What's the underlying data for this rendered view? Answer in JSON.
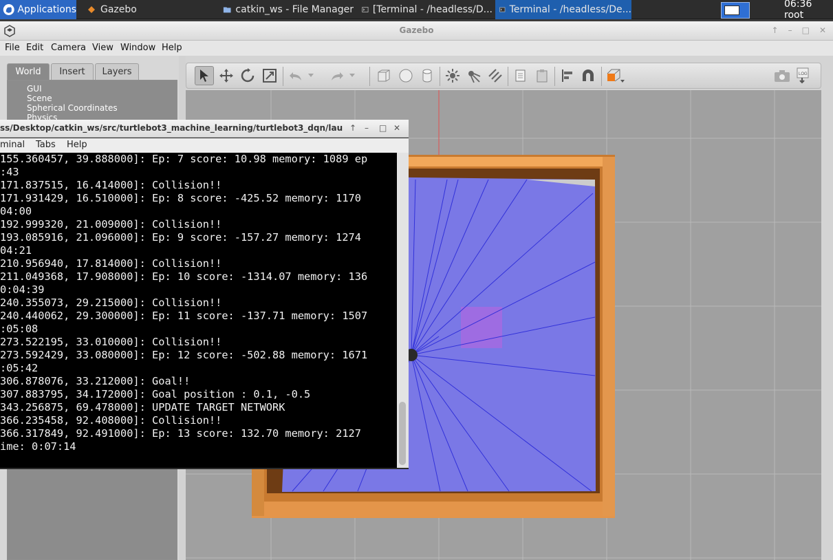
{
  "taskbar": {
    "apps_label": "Applications",
    "tasks": [
      "Gazebo",
      "catkin_ws - File Manager",
      "[Terminal - /headless/D...",
      "Terminal - /headless/De..."
    ],
    "clock": "06:36 root"
  },
  "gazebo": {
    "title": "Gazebo",
    "menu": [
      "File",
      "Edit",
      "Camera",
      "View",
      "Window",
      "Help"
    ],
    "tabs": [
      "World",
      "Insert",
      "Layers"
    ],
    "tree": [
      "GUI",
      "Scene",
      "Spherical Coordinates",
      "Physics"
    ],
    "toolbar_icons": [
      "select-arrow",
      "translate",
      "rotate",
      "scale",
      "undo",
      "redo",
      "box",
      "sphere",
      "cylinder",
      "point-light",
      "spot-light",
      "directional-light",
      "copy",
      "paste",
      "align",
      "snap",
      "color-picker",
      "screenshot",
      "log"
    ]
  },
  "terminal": {
    "title": "ss/Desktop/catkin_ws/src/turtlebot3_machine_learning/turtlebot3_dqn/lau",
    "menu": [
      "minal",
      "Tabs",
      "Help"
    ],
    "lines": [
      "155.360457, 39.888000]: Ep: 7 score: 10.98 memory: 1089 ep",
      ":43",
      "171.837515, 16.414000]: Collision!!",
      "171.931429, 16.510000]: Ep: 8 score: -425.52 memory: 1170",
      "04:00",
      "192.999320, 21.009000]: Collision!!",
      "193.085916, 21.096000]: Ep: 9 score: -157.27 memory: 1274",
      "04:21",
      "210.956940, 17.814000]: Collision!!",
      "211.049368, 17.908000]: Ep: 10 score: -1314.07 memory: 136",
      "0:04:39",
      "240.355073, 29.215000]: Collision!!",
      "240.440062, 29.300000]: Ep: 11 score: -137.71 memory: 1507",
      ":05:08",
      "273.522195, 33.010000]: Collision!!",
      "273.592429, 33.080000]: Ep: 12 score: -502.88 memory: 1671",
      ":05:42",
      "306.878076, 33.212000]: Goal!!",
      "307.883795, 34.172000]: Goal position : 0.1, -0.5",
      "343.256875, 69.478000]: UPDATE TARGET NETWORK",
      "366.235458, 92.408000]: Collision!!",
      "366.317849, 92.491000]: Ep: 13 score: 132.70 memory: 2127",
      "ime: 0:07:14"
    ]
  },
  "colors": {
    "taskbar": "#2d2d2d",
    "accent": "#2c68c4",
    "laser_fill": "#7a78e6",
    "frame_wood": "#d58a3c",
    "goal_marker": "#a46ae0"
  }
}
